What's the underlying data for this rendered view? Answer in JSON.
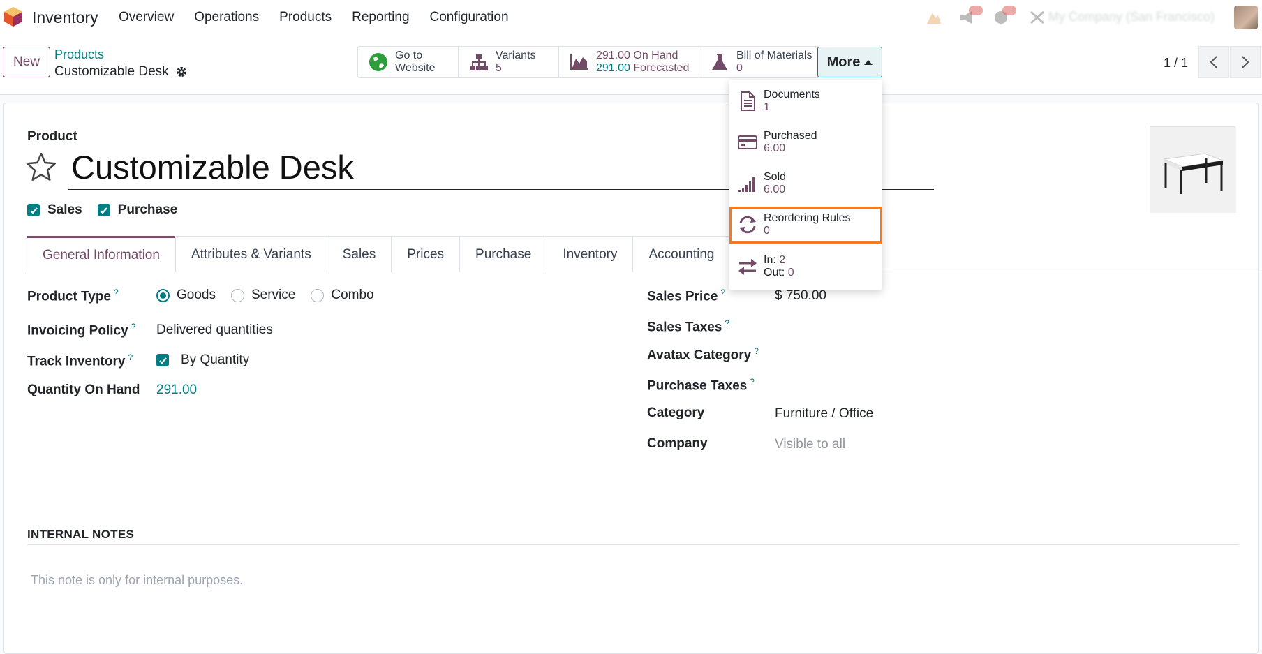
{
  "navbar": {
    "app_name": "Inventory",
    "menu": [
      "Overview",
      "Operations",
      "Products",
      "Reporting",
      "Configuration"
    ],
    "company": "My Company (San Francisco)"
  },
  "control_panel": {
    "new_label": "New",
    "breadcrumb": "Products",
    "record_name": "Customizable Desk",
    "pager": "1 / 1",
    "smart_buttons": {
      "website": {
        "line1": "Go to",
        "line2": "Website"
      },
      "variants": {
        "label": "Variants",
        "value": "5"
      },
      "on_hand": {
        "value1": "291.00",
        "label1": "On Hand",
        "value2": "291.00",
        "label2": "Forecasted"
      },
      "bom": {
        "label": "Bill of Materials",
        "value": "0"
      }
    },
    "more_label": "More"
  },
  "dropdown": {
    "items": [
      {
        "label": "Documents",
        "value": "1",
        "icon": "document-icon"
      },
      {
        "label": "Purchased",
        "value": "6.00",
        "icon": "credit-card-icon"
      },
      {
        "label": "Sold",
        "value": "6.00",
        "icon": "signal-bars-icon"
      },
      {
        "label": "Reordering Rules",
        "value": "0",
        "icon": "refresh-icon"
      },
      {
        "label_in": "In:",
        "value_in": "2",
        "label_out": "Out:",
        "value_out": "0",
        "icon": "exchange-arrows-icon"
      }
    ]
  },
  "form": {
    "product_label": "Product",
    "product_name": "Customizable Desk",
    "checkboxes": {
      "sales": "Sales",
      "purchase": "Purchase"
    },
    "tabs": [
      "General Information",
      "Attributes & Variants",
      "Sales",
      "Prices",
      "Purchase",
      "Inventory",
      "Accounting"
    ],
    "left": {
      "product_type_label": "Product Type",
      "product_type_options": [
        "Goods",
        "Service",
        "Combo"
      ],
      "product_type_selected": "Goods",
      "invoicing_policy_label": "Invoicing Policy",
      "invoicing_policy_value": "Delivered quantities",
      "track_inventory_label": "Track Inventory",
      "track_inventory_value": "By Quantity",
      "qty_on_hand_label": "Quantity On Hand",
      "qty_on_hand_value": "291.00"
    },
    "right": {
      "sales_price_label": "Sales Price",
      "sales_price_value": "$ 750.00",
      "sales_taxes_label": "Sales Taxes",
      "avatax_label": "Avatax Category",
      "purchase_taxes_label": "Purchase Taxes",
      "category_label": "Category",
      "category_value": "Furniture / Office",
      "company_label": "Company",
      "company_value": "Visible to all"
    },
    "help_mark": "?",
    "internal_notes_title": "INTERNAL NOTES",
    "internal_notes_placeholder": "This note is only for internal purposes."
  },
  "colors": {
    "brand": "#714b67",
    "teal": "#017e84",
    "highlight": "#f47a20"
  }
}
